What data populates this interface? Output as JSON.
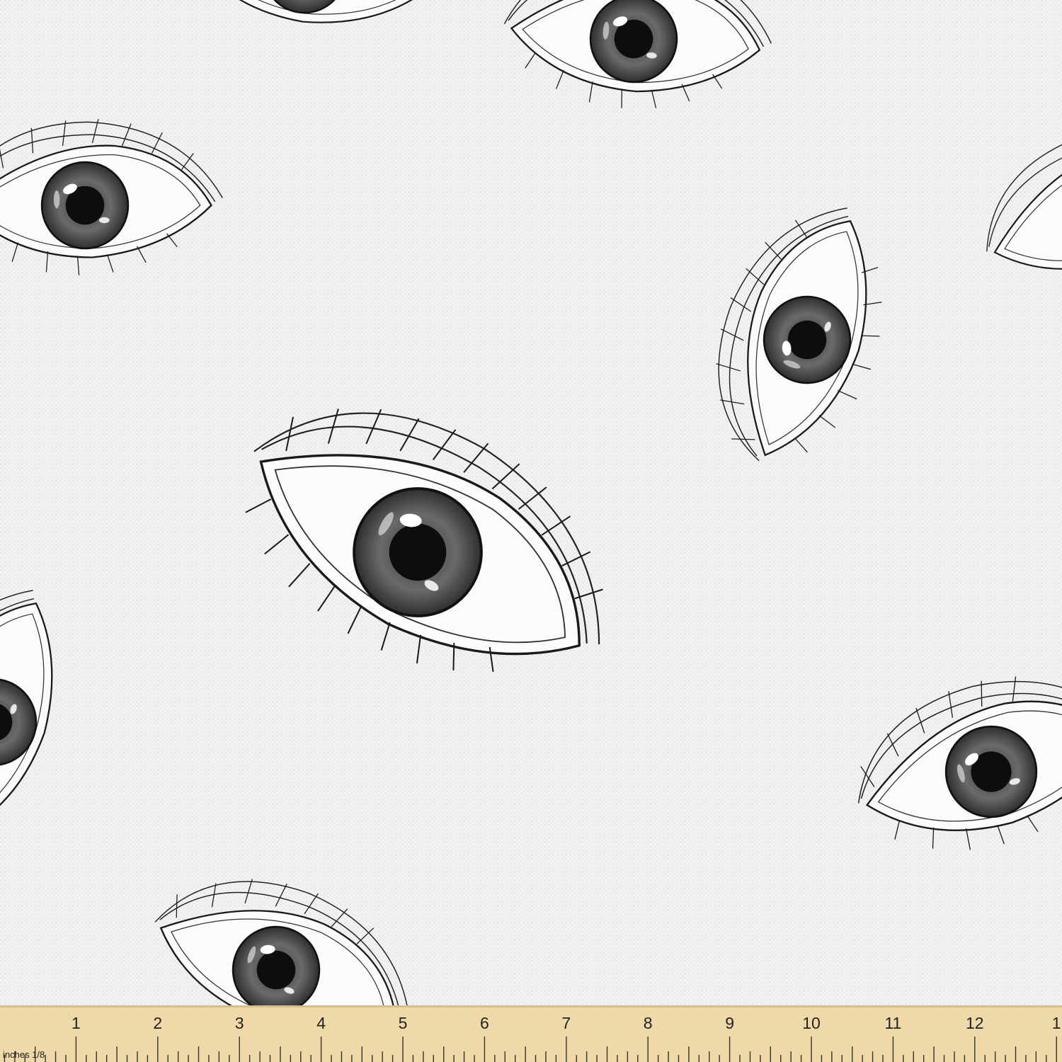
{
  "colors": {
    "fabric": "#f2f2f0",
    "ink": "#1a1a1a",
    "iris": "#555555",
    "ruler": "#f0d9a8",
    "ruler_edge": "#d8bd84"
  },
  "ruler": {
    "unit_label": "inches 1/8",
    "numbers": [
      "1",
      "2",
      "3",
      "4",
      "5",
      "6",
      "7",
      "8",
      "9",
      "10",
      "11",
      "12",
      "1"
    ]
  }
}
